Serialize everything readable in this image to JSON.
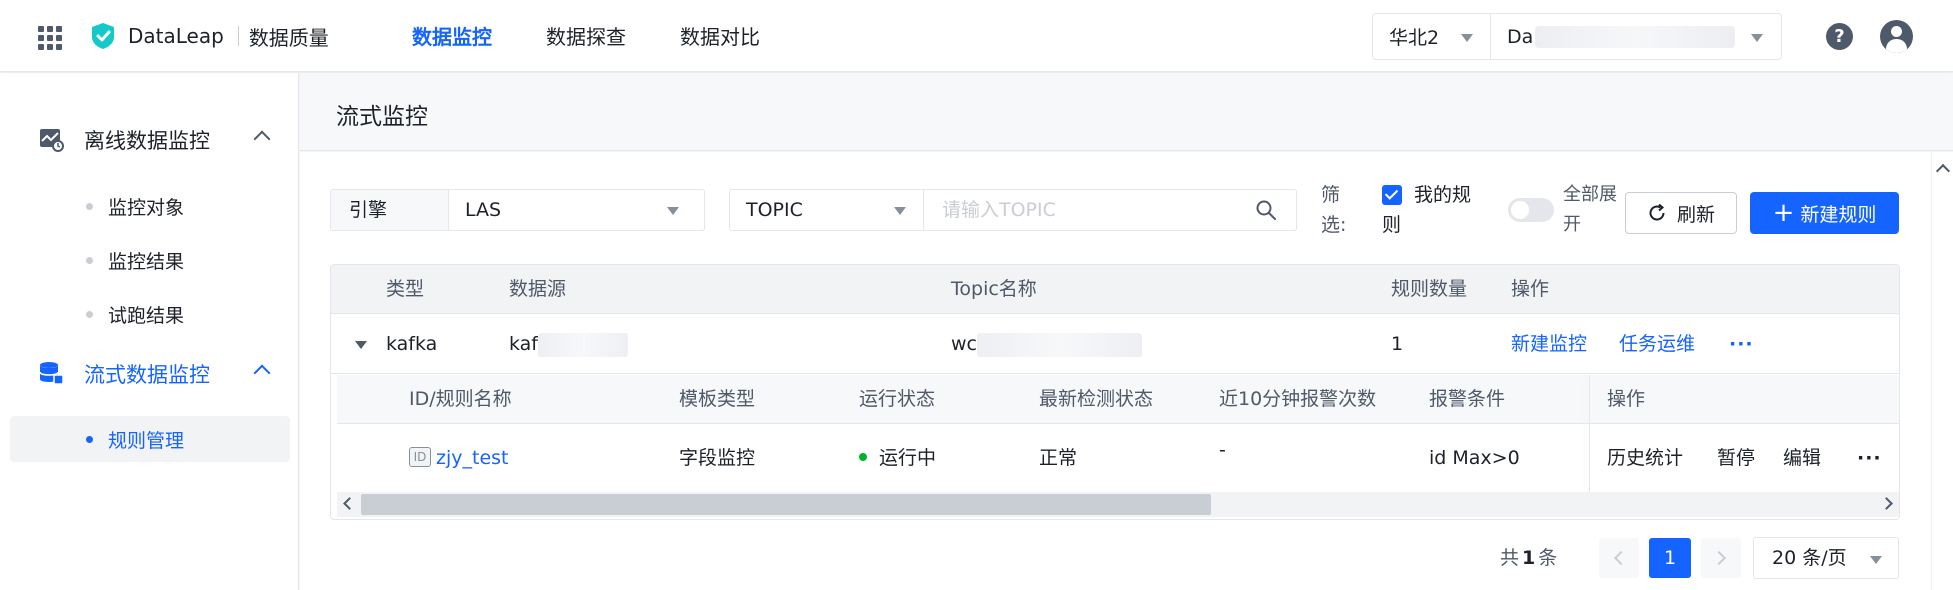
{
  "header": {
    "brand_name": "DataLeap",
    "product_name": "数据质量",
    "nav": [
      "数据监控",
      "数据探查",
      "数据对比"
    ],
    "active_nav": "数据监控",
    "region": "华北2",
    "project_prefix": "Da",
    "help_glyph": "?"
  },
  "sidebar": {
    "groups": [
      {
        "label": "离线数据监控",
        "items": [
          "监控对象",
          "监控结果",
          "试跑结果"
        ]
      },
      {
        "label": "流式数据监控",
        "items": [
          "规则管理"
        ]
      }
    ],
    "active_item": "规则管理"
  },
  "page": {
    "title": "流式监控"
  },
  "filters": {
    "engine_label": "引擎",
    "engine_value": "LAS",
    "topic_type": "TOPIC",
    "topic_placeholder": "请输入TOPIC",
    "filter_label": "筛选:",
    "my_rules_label": "我的规则",
    "my_rules_checked": true,
    "expand_all_label": "全部展开",
    "expand_all_on": false,
    "refresh_label": "刷新",
    "new_rule_label": "新建规则"
  },
  "table": {
    "columns": [
      "类型",
      "数据源",
      "Topic名称",
      "规则数量",
      "操作"
    ],
    "rows": [
      {
        "type": "kafka",
        "source_prefix": "kaf",
        "topic_prefix": "wc",
        "rule_count": "1",
        "actions": [
          "新建监控",
          "任务运维"
        ],
        "more": "···",
        "rules": {
          "columns": [
            "ID/规则名称",
            "模板类型",
            "运行状态",
            "最新检测状态",
            "近10分钟报警次数",
            "报警条件",
            "操作"
          ],
          "rows": [
            {
              "id_badge": "ID",
              "name": "zjy_test",
              "template": "字段监控",
              "run_status": "运行中",
              "check_status": "正常",
              "alarm_count": "-",
              "condition": "id Max>0",
              "actions": [
                "历史统计",
                "暂停",
                "编辑"
              ],
              "more": "···"
            }
          ]
        }
      }
    ]
  },
  "pagination": {
    "total_prefix": "共",
    "total": "1",
    "total_suffix": "条",
    "current_page": "1",
    "page_size": "20 条/页"
  },
  "colors": {
    "primary": "#1664ff",
    "success": "#00b42a",
    "text": "#1d2129",
    "muted": "#4e5969"
  }
}
